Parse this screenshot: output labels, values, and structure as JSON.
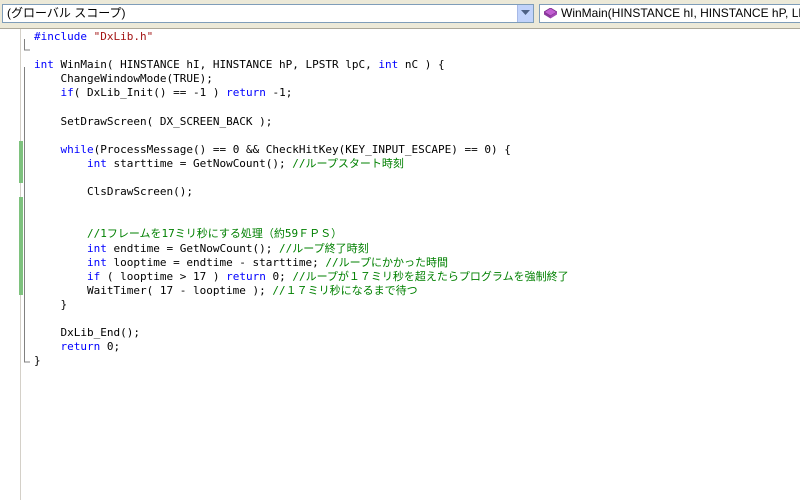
{
  "toolbar": {
    "scope_combo": "(グローバル スコープ)",
    "member_combo": "WinMain(HINSTANCE hI, HINSTANCE hP, LPSTR lpC, int nC)"
  },
  "code_lines": [
    {
      "pp": "#include",
      "str": "\"DxLib.h\""
    },
    {
      "text": ""
    },
    {
      "kw1": "int",
      "text": " WinMain( HINSTANCE hI, HINSTANCE hP, LPSTR lpC, ",
      "kw2": "int",
      "rest": " nC ) {"
    },
    {
      "indent": "    ",
      "text": "ChangeWindowMode(TRUE);"
    },
    {
      "indent": "    ",
      "kw1": "if",
      "text": "( DxLib_Init() == -1 ) ",
      "kw2": "return",
      "rest": " -1;"
    },
    {
      "text": ""
    },
    {
      "indent": "    ",
      "text": "SetDrawScreen( DX_SCREEN_BACK );"
    },
    {
      "text": ""
    },
    {
      "indent": "    ",
      "kw1": "while",
      "text": "(ProcessMessage() == 0 && CheckHitKey(KEY_INPUT_ESCAPE) == 0) {"
    },
    {
      "indent": "        ",
      "kw1": "int",
      "text": " starttime = GetNowCount(); ",
      "cm": "//ループスタート時刻"
    },
    {
      "text": ""
    },
    {
      "indent": "        ",
      "text": "ClsDrawScreen();"
    },
    {
      "text": ""
    },
    {
      "text": ""
    },
    {
      "indent": "        ",
      "cm": "//1フレームを17ミリ秒にする処理（約59ＦＰＳ）"
    },
    {
      "indent": "        ",
      "kw1": "int",
      "text": " endtime = GetNowCount(); ",
      "cm": "//ループ終了時刻"
    },
    {
      "indent": "        ",
      "kw1": "int",
      "text": " looptime = endtime - starttime; ",
      "cm": "//ループにかかった時間"
    },
    {
      "indent": "        ",
      "kw1": "if",
      "text": " ( looptime > 17 ) ",
      "kw2": "return",
      "rest": " 0; ",
      "cm": "//ループが１７ミリ秒を超えたらプログラムを強制終了"
    },
    {
      "indent": "        ",
      "text": "WaitTimer( 17 - looptime ); ",
      "cm": "//１７ミリ秒になるまで待つ"
    },
    {
      "indent": "    ",
      "text": "}"
    },
    {
      "text": ""
    },
    {
      "indent": "    ",
      "text": "DxLib_End();"
    },
    {
      "indent": "    ",
      "kw1": "return",
      "text": " 0;"
    },
    {
      "text": "}"
    }
  ]
}
